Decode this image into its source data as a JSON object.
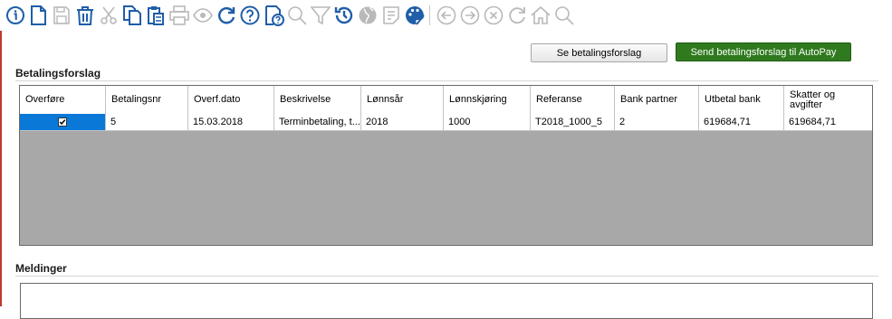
{
  "toolbar": {
    "icons": [
      "info-icon",
      "new-document-icon",
      "save-icon",
      "delete-icon",
      "cut-icon",
      "copy-icon",
      "paste-icon",
      "print-icon",
      "preview-icon",
      "refresh-icon",
      "help-icon",
      "help-document-icon",
      "search-icon",
      "filter-icon",
      "history-icon",
      "globe-icon",
      "notes-icon",
      "palette-icon",
      "back-icon",
      "forward-icon",
      "cancel-icon",
      "reload-icon",
      "home-icon",
      "find-icon"
    ]
  },
  "actions": {
    "show_suggestion": "Se betalingsforslag",
    "send_suggestion": "Send betalingsforslag til AutoPay"
  },
  "payment_section": {
    "title": "Betalingsforslag"
  },
  "grid": {
    "columns": [
      "Overføre",
      "Betalingsnr",
      "Overf.dato",
      "Beskrivelse",
      "Lønnsår",
      "Lønnskjøring",
      "Referanse",
      "Bank partner",
      "Utbetal bank",
      "Skatter og avgifter"
    ],
    "rows": [
      {
        "transfer": true,
        "payment_no": "5",
        "transfer_date": "15.03.2018",
        "description": "Terminbetaling, t...",
        "salary_year": "2018",
        "payroll_run": "1000",
        "reference": "T2018_1000_5",
        "bank_partner": "2",
        "payout_bank": "619684,71",
        "taxes": "619684,71"
      }
    ]
  },
  "messages_section": {
    "title": "Meldinger"
  },
  "colors": {
    "accent_green": "#2f7a1e",
    "selection_blue": "#0a78d7",
    "toolbar_icon_blue": "#1f5ea8",
    "left_accent": "#c0392b"
  }
}
